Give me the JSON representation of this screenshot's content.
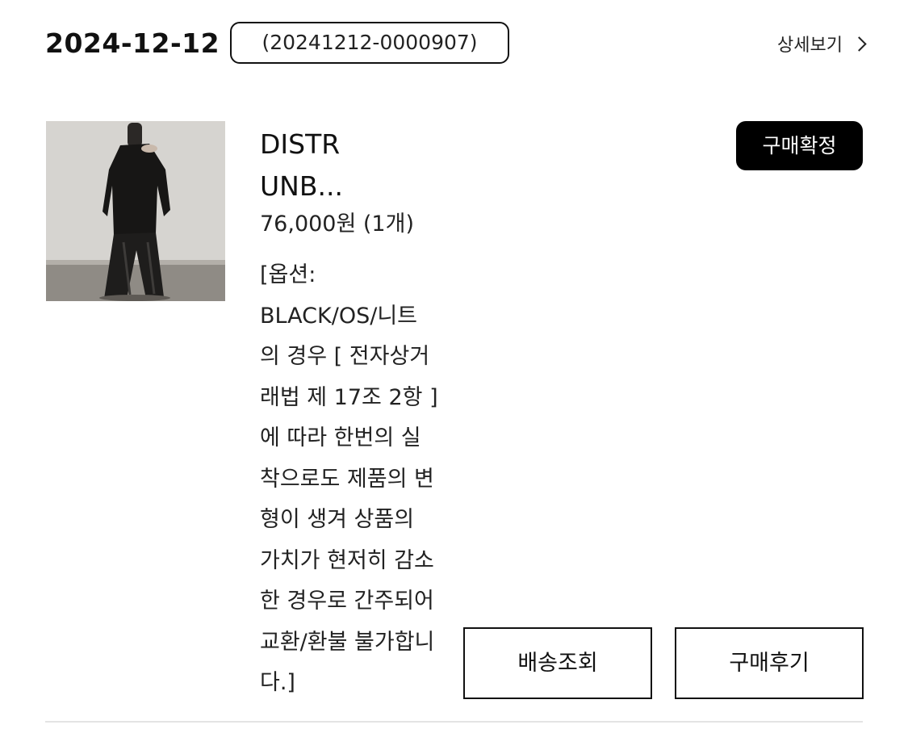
{
  "order": {
    "date": "2024-12-12",
    "number": "(20241212-0000907)",
    "detail_link": "상세보기"
  },
  "product": {
    "name_lines": [
      "DISTR",
      "UNB..."
    ],
    "price": "76,000원 (1개)",
    "option_lines": [
      "[옵션:",
      "BLACK/OS/니트",
      "의 경우 [ 전자상거",
      "래법 제 17조 2항 ]",
      "에 따라 한번의 실",
      "착으로도 제품의 변",
      "형이 생겨 상품의",
      "가치가 현저히 감소",
      "한 경우로 간주되어",
      "교환/환불 불가합니",
      "다.]"
    ]
  },
  "buttons": {
    "confirm": "구매확정",
    "track": "배송조회",
    "review": "구매후기"
  },
  "icons": {
    "detail": "chevron-right-icon"
  },
  "colors": {
    "text": "#111111",
    "button_bg": "#000000",
    "button_text": "#ffffff",
    "divider": "#e4e4e4"
  }
}
